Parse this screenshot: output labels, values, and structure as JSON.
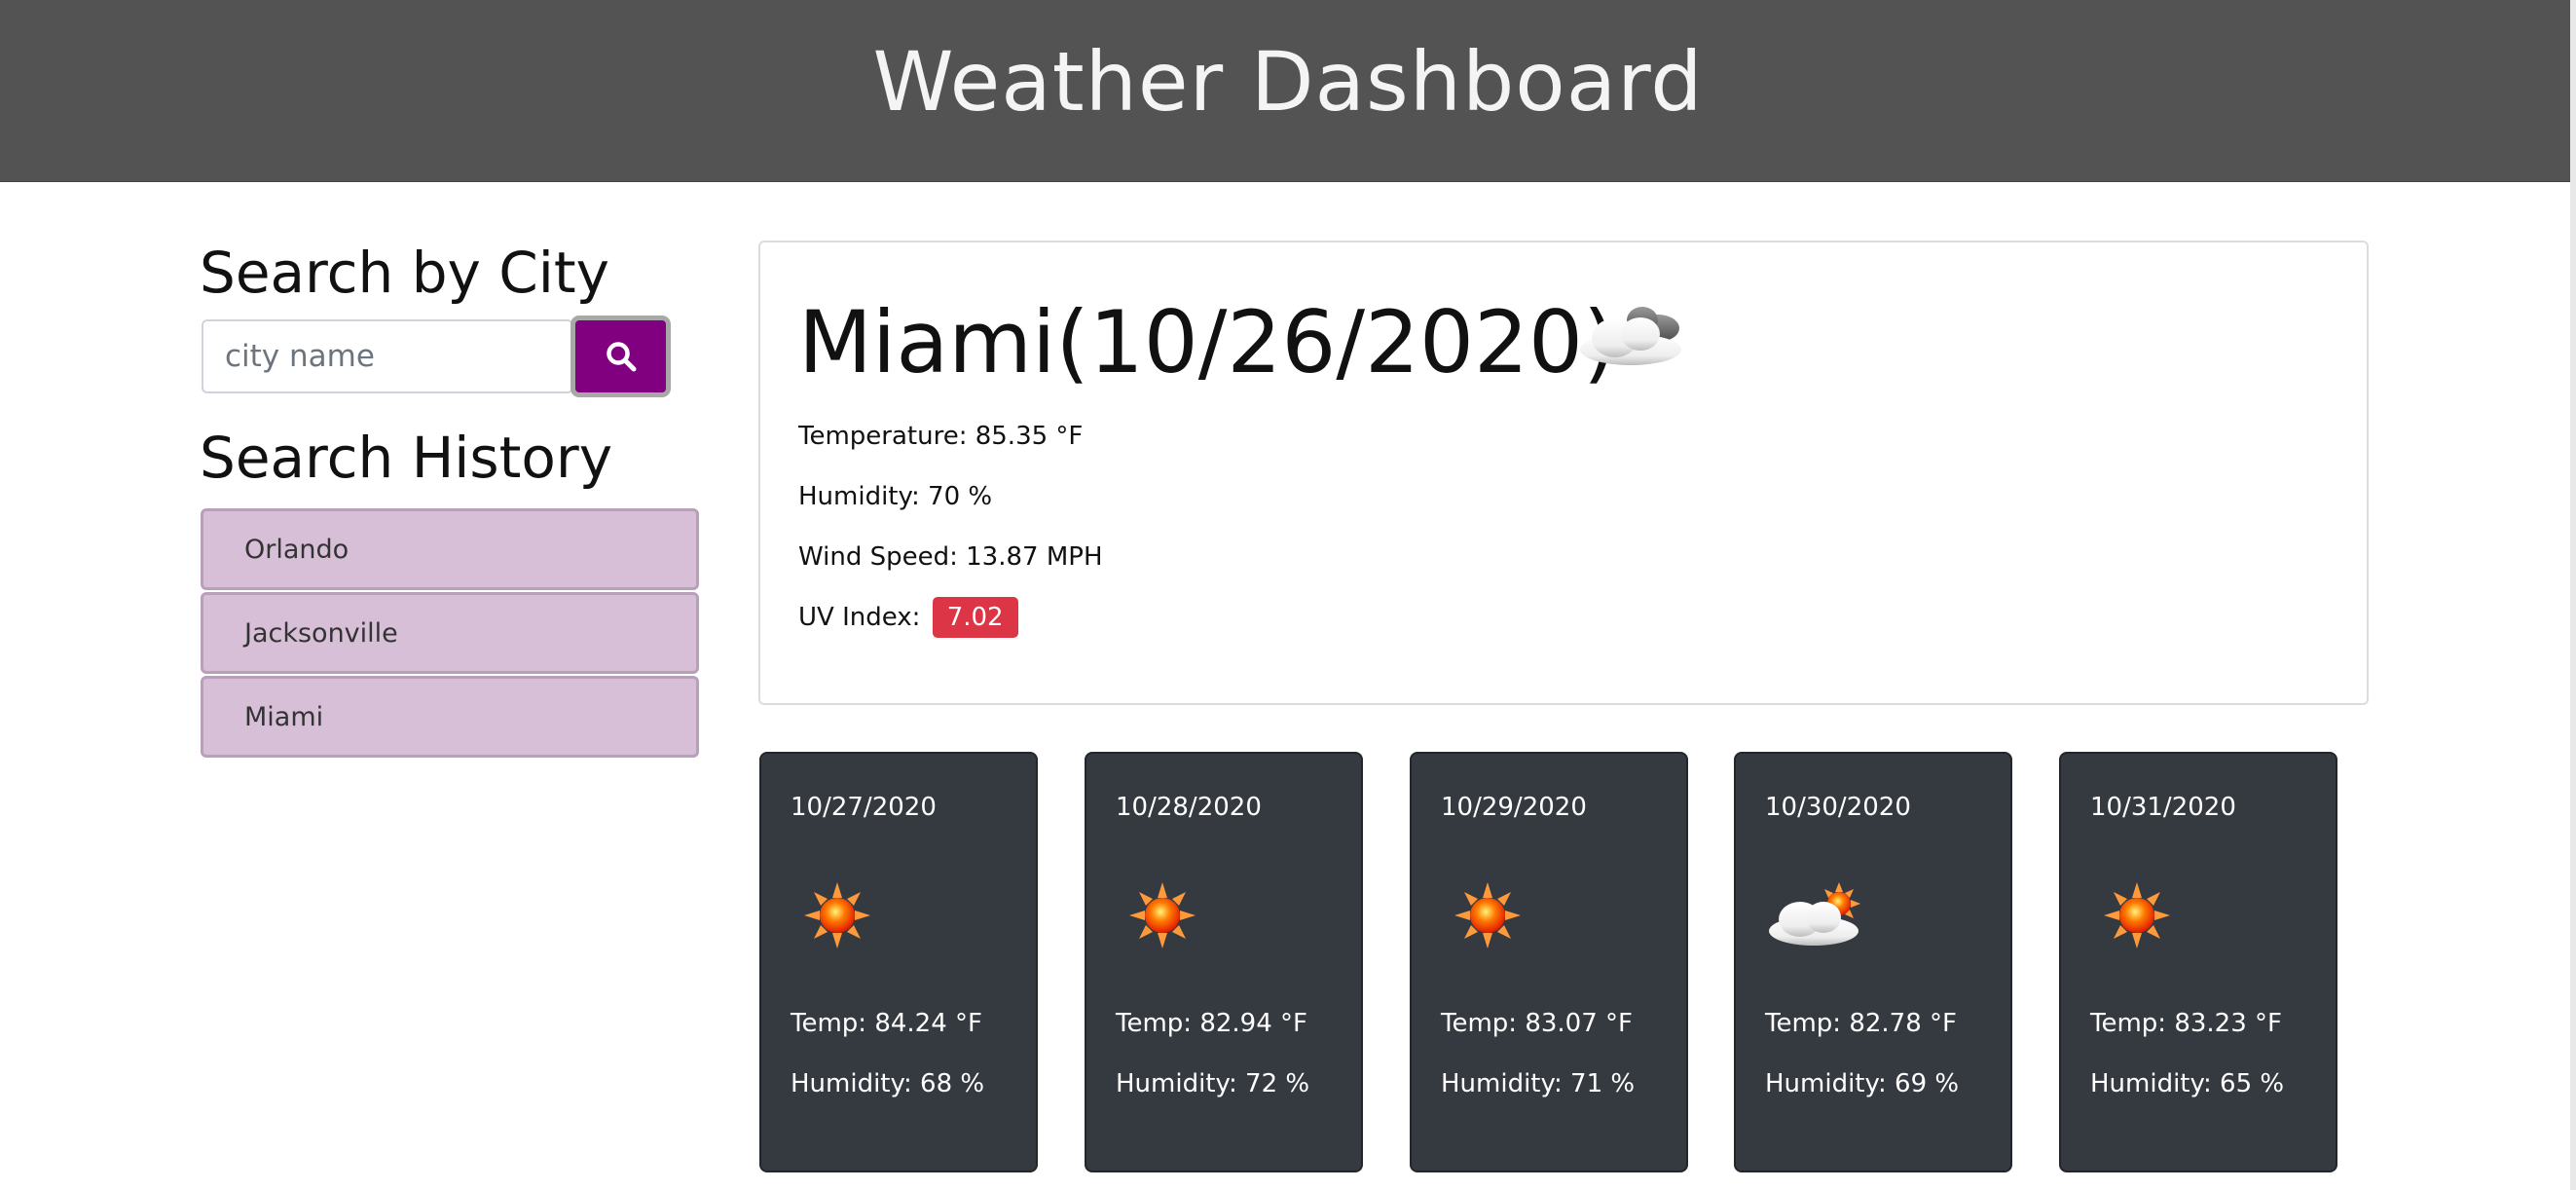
{
  "header": {
    "title": "Weather Dashboard"
  },
  "sidebar": {
    "search_title": "Search by City",
    "search_placeholder": "city name",
    "search_value": "",
    "search_button_icon": "search-icon",
    "history_title": "Search History",
    "history": [
      {
        "label": "Orlando"
      },
      {
        "label": "Jacksonville"
      },
      {
        "label": "Miami"
      }
    ]
  },
  "current": {
    "title": "Miami(10/26/2020)",
    "icon": "cloudy-icon",
    "temperature": "Temperature: 85.35 °F",
    "humidity": "Humidity: 70 %",
    "wind": "Wind Speed: 13.87 MPH",
    "uv_label": "UV Index:",
    "uv_value": "7.02",
    "uv_color": "#dc3545"
  },
  "forecast": [
    {
      "date": "10/27/2020",
      "icon": "sun-icon",
      "temp": "Temp: 84.24 °F",
      "humidity": "Humidity: 68 %"
    },
    {
      "date": "10/28/2020",
      "icon": "sun-icon",
      "temp": "Temp: 82.94 °F",
      "humidity": "Humidity: 72 %"
    },
    {
      "date": "10/29/2020",
      "icon": "sun-icon",
      "temp": "Temp: 83.07 °F",
      "humidity": "Humidity: 71 %"
    },
    {
      "date": "10/30/2020",
      "icon": "partly-cloudy-icon",
      "temp": "Temp: 82.78 °F",
      "humidity": "Humidity: 69 %"
    },
    {
      "date": "10/31/2020",
      "icon": "sun-icon",
      "temp": "Temp: 83.23 °F",
      "humidity": "Humidity: 65 %"
    }
  ],
  "colors": {
    "header_bg": "#545354",
    "search_button": "#800080",
    "history_bg": "#d8bfd8",
    "forecast_bg": "#343a40",
    "uv_badge": "#dc3545"
  }
}
